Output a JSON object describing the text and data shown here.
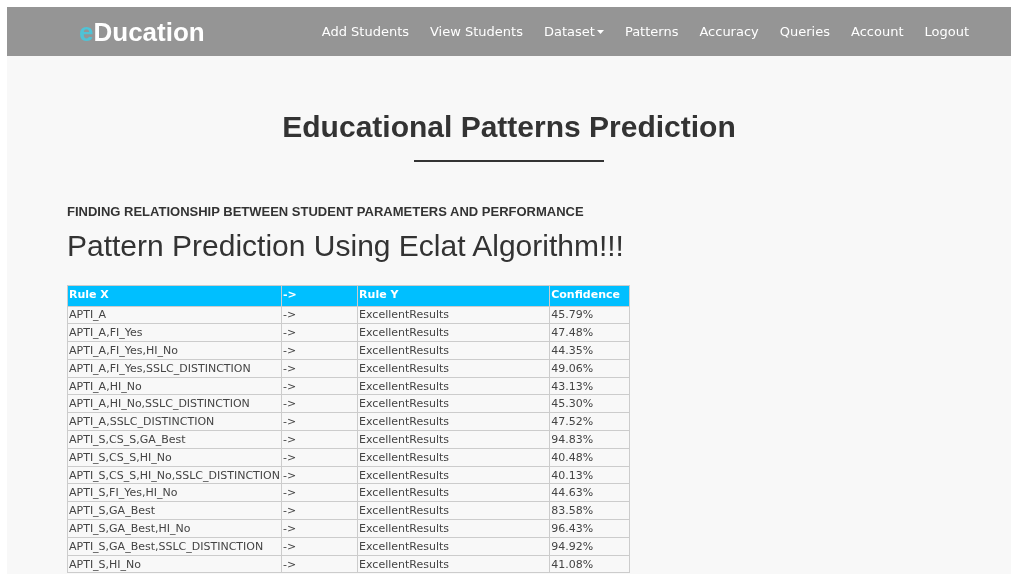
{
  "navbar": {
    "logo": {
      "accent": "e",
      "rest": "Ducation"
    },
    "items": [
      {
        "label": "Add Students",
        "kind": "link"
      },
      {
        "label": "View Students",
        "kind": "link"
      },
      {
        "label": "Dataset",
        "kind": "dropdown"
      },
      {
        "label": "Patterns",
        "kind": "link"
      },
      {
        "label": "Accuracy",
        "kind": "link"
      },
      {
        "label": "Queries",
        "kind": "link"
      },
      {
        "label": "Account",
        "kind": "link"
      },
      {
        "label": "Logout",
        "kind": "link"
      }
    ]
  },
  "page_title": "Educational Patterns Prediction",
  "subtitle": "FINDING RELATIONSHIP BETWEEN STUDENT PARAMETERS AND PERFORMANCE",
  "heading": "Pattern Prediction Using Eclat Algorithm!!!",
  "table": {
    "columns": [
      "Rule X",
      "->",
      "Rule Y",
      "Confidence"
    ],
    "rows": [
      [
        "APTI_A",
        "->",
        "ExcellentResults",
        "45.79%"
      ],
      [
        "APTI_A,FI_Yes",
        "->",
        "ExcellentResults",
        "47.48%"
      ],
      [
        "APTI_A,FI_Yes,HI_No",
        "->",
        "ExcellentResults",
        "44.35%"
      ],
      [
        "APTI_A,FI_Yes,SSLC_DISTINCTION",
        "->",
        "ExcellentResults",
        "49.06%"
      ],
      [
        "APTI_A,HI_No",
        "->",
        "ExcellentResults",
        "43.13%"
      ],
      [
        "APTI_A,HI_No,SSLC_DISTINCTION",
        "->",
        "ExcellentResults",
        "45.30%"
      ],
      [
        "APTI_A,SSLC_DISTINCTION",
        "->",
        "ExcellentResults",
        "47.52%"
      ],
      [
        "APTI_S,CS_S,GA_Best",
        "->",
        "ExcellentResults",
        "94.83%"
      ],
      [
        "APTI_S,CS_S,HI_No",
        "->",
        "ExcellentResults",
        "40.48%"
      ],
      [
        "APTI_S,CS_S,HI_No,SSLC_DISTINCTION",
        "->",
        "ExcellentResults",
        "40.13%"
      ],
      [
        "APTI_S,FI_Yes,HI_No",
        "->",
        "ExcellentResults",
        "44.63%"
      ],
      [
        "APTI_S,GA_Best",
        "->",
        "ExcellentResults",
        "83.58%"
      ],
      [
        "APTI_S,GA_Best,HI_No",
        "->",
        "ExcellentResults",
        "96.43%"
      ],
      [
        "APTI_S,GA_Best,SSLC_DISTINCTION",
        "->",
        "ExcellentResults",
        "94.92%"
      ],
      [
        "APTI_S,HI_No",
        "->",
        "ExcellentResults",
        "41.08%"
      ]
    ]
  }
}
